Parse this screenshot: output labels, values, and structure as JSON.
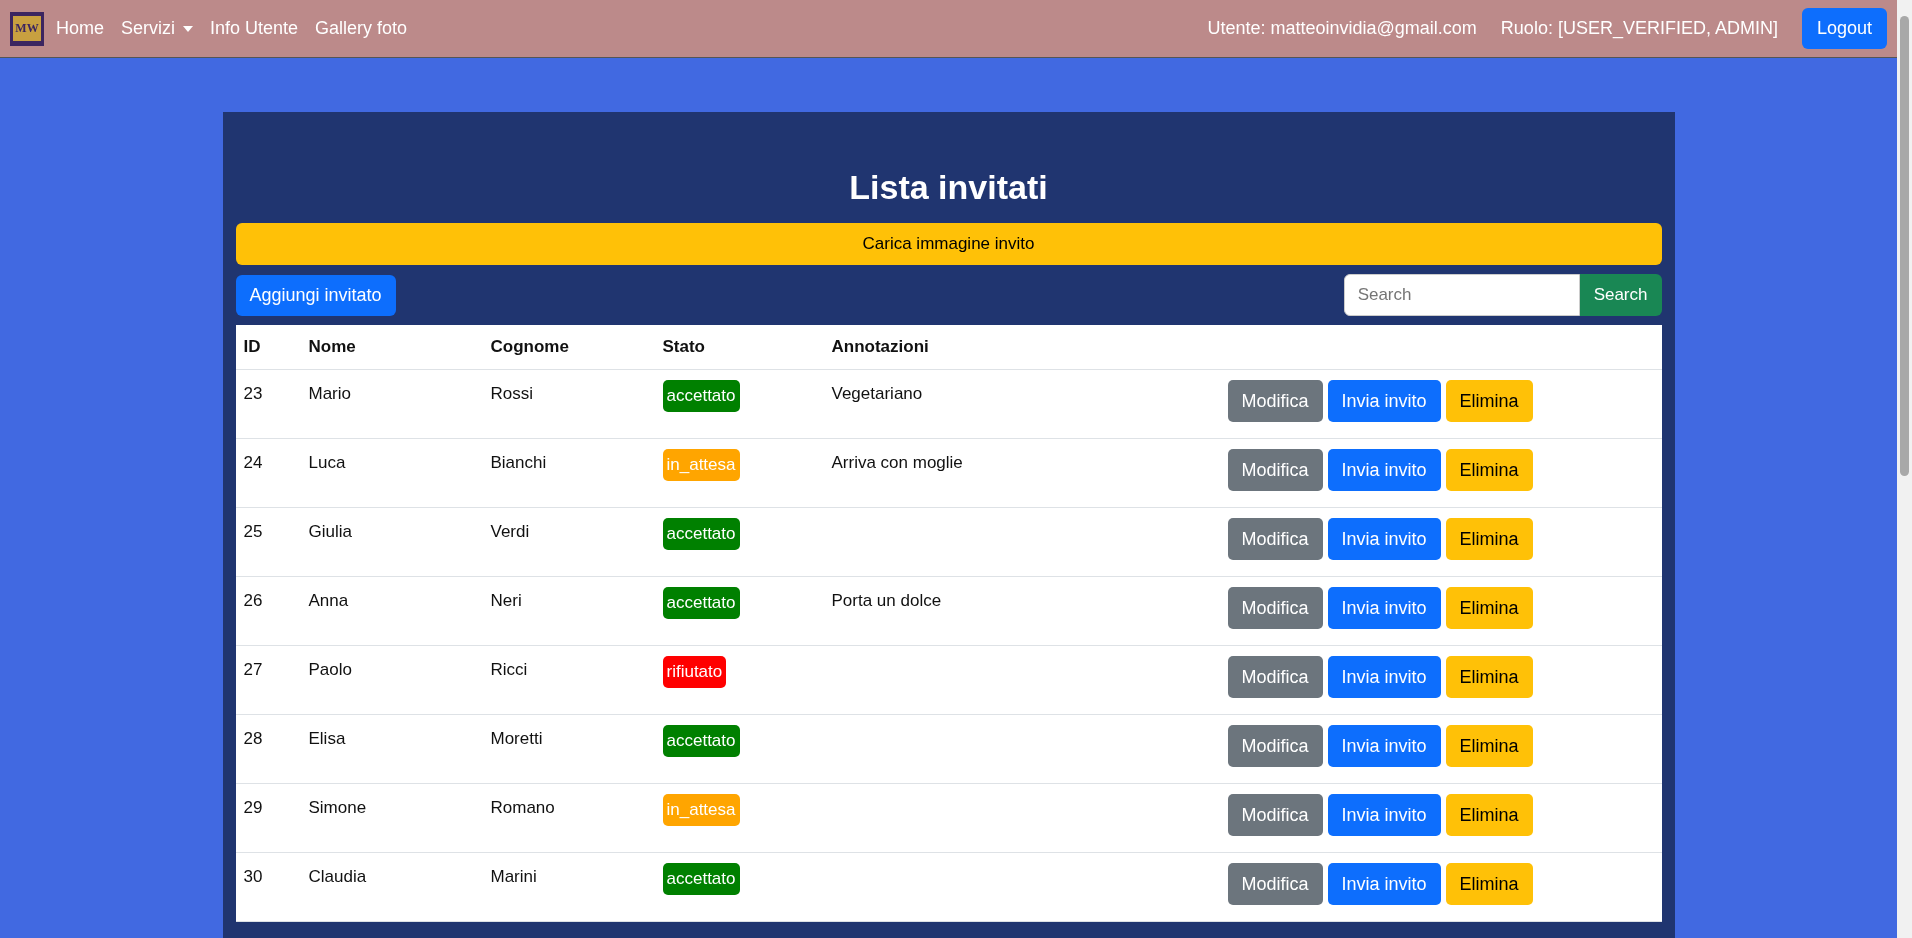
{
  "navbar": {
    "logo_text": "MW",
    "links": [
      {
        "label": "Home",
        "kind": "link"
      },
      {
        "label": "Servizi",
        "kind": "dropdown"
      },
      {
        "label": "Info Utente",
        "kind": "link"
      },
      {
        "label": "Gallery foto",
        "kind": "link"
      }
    ],
    "user": "Utente: matteoinvidia@gmail.com",
    "role": "Ruolo: [USER_VERIFIED, ADMIN]",
    "logout": "Logout"
  },
  "title": "Lista invitati",
  "upload_button": "Carica immagine invito",
  "add_button": "Aggiungi invitato",
  "search": {
    "placeholder": "Search",
    "button": "Search"
  },
  "table": {
    "columns": [
      "ID",
      "Nome",
      "Cognome",
      "Stato",
      "Annotazioni"
    ],
    "rows": [
      {
        "id": "23",
        "nome": "Mario",
        "cognome": "Rossi",
        "stato": "accettato",
        "color": "#008000",
        "note": "Vegetariano",
        "actions": [
          "Modifica",
          "Invia invito",
          "Elimina"
        ]
      },
      {
        "id": "24",
        "nome": "Luca",
        "cognome": "Bianchi",
        "stato": "in_attesa",
        "color": "#ffa500",
        "note": "Arriva con moglie",
        "actions": [
          "Modifica",
          "Invia invito",
          "Elimina"
        ]
      },
      {
        "id": "25",
        "nome": "Giulia",
        "cognome": "Verdi",
        "stato": "accettato",
        "color": "#008000",
        "actions": [
          "Modifica",
          "Invia invito",
          "Elimina"
        ]
      },
      {
        "id": "26",
        "nome": "Anna",
        "cognome": "Neri",
        "stato": "accettato",
        "color": "#008000",
        "note": "Porta un dolce",
        "actions": [
          "Modifica",
          "Invia invito",
          "Elimina"
        ]
      },
      {
        "id": "27",
        "nome": "Paolo",
        "cognome": "Ricci",
        "stato": "rifiutato",
        "color": "#ff0000",
        "actions": [
          "Modifica",
          "Invia invito",
          "Elimina"
        ]
      },
      {
        "id": "28",
        "nome": "Elisa",
        "cognome": "Moretti",
        "stato": "accettato",
        "color": "#008000",
        "actions": [
          "Modifica",
          "Invia invito",
          "Elimina"
        ]
      },
      {
        "id": "29",
        "nome": "Simone",
        "cognome": "Romano",
        "stato": "in_attesa",
        "color": "#ffa500",
        "actions": [
          "Modifica",
          "Invia invito",
          "Elimina"
        ]
      },
      {
        "id": "30",
        "nome": "Claudia",
        "cognome": "Marini",
        "stato": "accettato",
        "color": "#008000",
        "actions": [
          "Modifica",
          "Invia invito",
          "Elimina"
        ]
      }
    ]
  }
}
